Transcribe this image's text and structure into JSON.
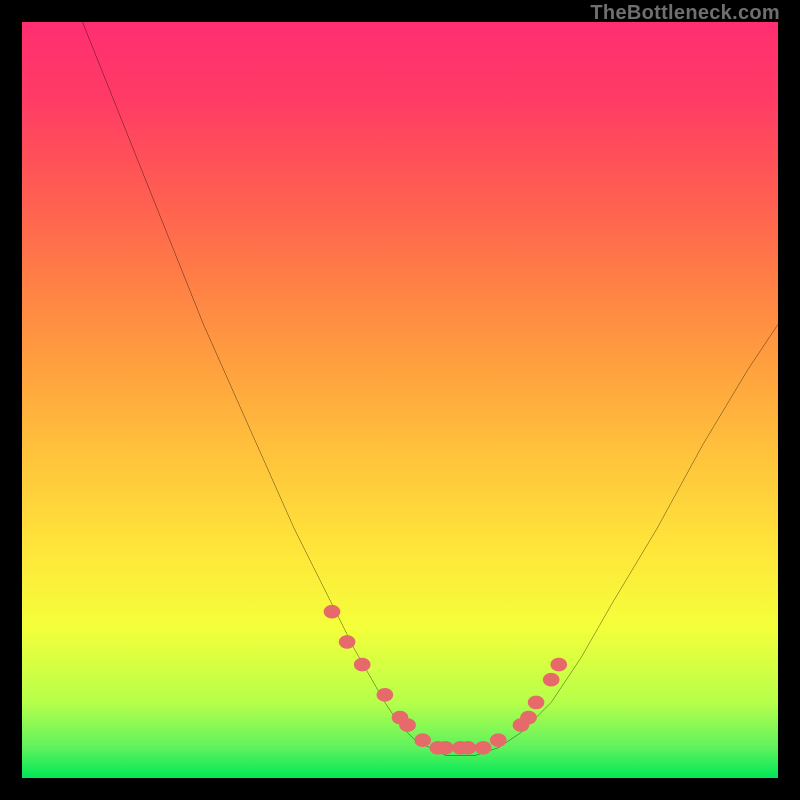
{
  "watermark": "TheBottleneck.com",
  "chart_data": {
    "type": "line",
    "title": "",
    "xlabel": "",
    "ylabel": "",
    "xlim": [
      0,
      100
    ],
    "ylim": [
      0,
      100
    ],
    "grid": false,
    "legend": false,
    "series": [
      {
        "name": "bottleneck-curve",
        "x": [
          8,
          12,
          16,
          20,
          24,
          28,
          32,
          36,
          40,
          44,
          48,
          50,
          52,
          54,
          56,
          58,
          60,
          63,
          66,
          70,
          74,
          78,
          84,
          90,
          96,
          100
        ],
        "y": [
          100,
          90,
          80,
          70,
          60,
          51,
          42,
          33,
          25,
          17,
          10,
          7,
          5,
          4,
          3,
          3,
          3,
          4,
          6,
          10,
          16,
          23,
          33,
          44,
          54,
          60
        ]
      }
    ],
    "markers": {
      "name": "highlight-points",
      "color": "#e66a6a",
      "x": [
        41,
        43,
        45,
        48,
        50,
        51,
        53,
        55,
        56,
        58,
        59,
        61,
        63,
        66,
        67,
        68,
        70,
        71
      ],
      "y": [
        22,
        18,
        15,
        11,
        8,
        7,
        5,
        4,
        4,
        4,
        4,
        4,
        5,
        7,
        8,
        10,
        13,
        15
      ]
    },
    "background_gradient": {
      "bottom": "#00e756",
      "mid_low": "#f4ff3a",
      "mid_high": "#ffa23e",
      "top": "#ff2e72"
    }
  }
}
